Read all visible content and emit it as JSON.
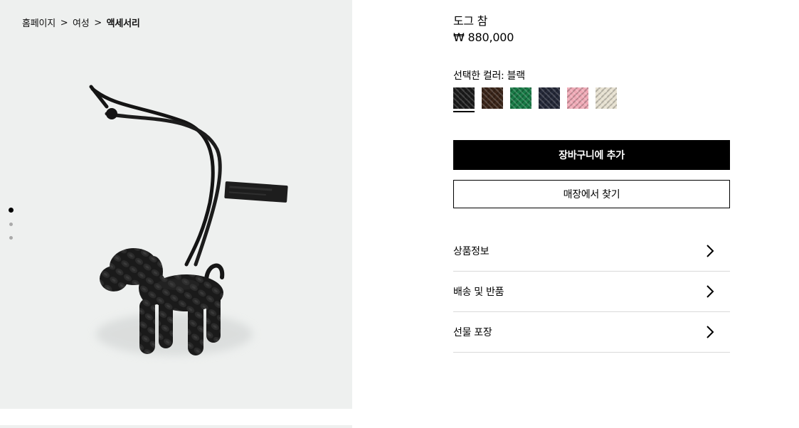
{
  "breadcrumb": {
    "items": [
      "홈페이지",
      "여성",
      "액세서리"
    ],
    "separator": ">"
  },
  "gallery": {
    "image_icon": "dog-charm-product-image",
    "background": "#eef0ef",
    "dots": 3,
    "active_index": 0
  },
  "product": {
    "name": "도그 참",
    "price": "₩ 880,000"
  },
  "colors": {
    "label": "선택한 컬러: 블랙",
    "selected_index": 0,
    "swatches": [
      {
        "name": "black",
        "color": "#1b1b1b"
      },
      {
        "name": "brown",
        "color": "#3a2418"
      },
      {
        "name": "green",
        "color": "#177a45"
      },
      {
        "name": "navy",
        "color": "#242838"
      },
      {
        "name": "pink",
        "color": "#f0a9b6"
      },
      {
        "name": "cream",
        "color": "#e6e0d0"
      }
    ]
  },
  "buttons": {
    "add_to_cart": "장바구니에 추가",
    "find_in_store": "매장에서 찾기"
  },
  "accordion": {
    "items": [
      {
        "label": "상품정보",
        "icon": "chevron-right-icon"
      },
      {
        "label": "배송 및 반품",
        "icon": "chevron-right-icon"
      },
      {
        "label": "선물 포장",
        "icon": "chevron-right-icon"
      }
    ]
  }
}
